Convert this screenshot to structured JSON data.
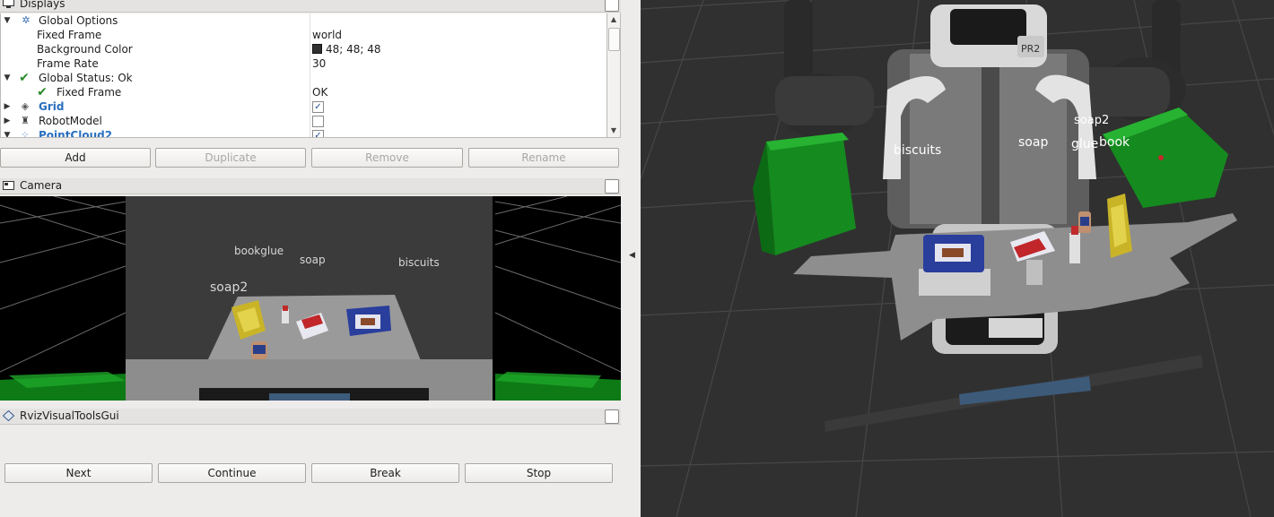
{
  "displays": {
    "title": "Displays",
    "rows": [
      {
        "label": "Global Options",
        "value": ""
      },
      {
        "label": "Fixed Frame",
        "value": "world"
      },
      {
        "label": "Background Color",
        "value": "48; 48; 48"
      },
      {
        "label": "Frame Rate",
        "value": "30"
      },
      {
        "label": "Global Status: Ok",
        "value": ""
      },
      {
        "label": "Fixed Frame",
        "value": "OK"
      },
      {
        "label": "Grid",
        "value": "",
        "checked": true
      },
      {
        "label": "RobotModel",
        "value": "",
        "checked": false
      },
      {
        "label": "PointCloud2",
        "value": "",
        "checked": true
      }
    ],
    "buttons": {
      "add": "Add",
      "duplicate": "Duplicate",
      "remove": "Remove",
      "rename": "Rename"
    }
  },
  "camera": {
    "title": "Camera",
    "labels": {
      "bookglue": "bookglue",
      "soap": "soap",
      "biscuits": "biscuits",
      "soap2": "soap2"
    }
  },
  "rviz_tools": {
    "title": "RvizVisualToolsGui",
    "buttons": {
      "next": "Next",
      "continue": "Continue",
      "break": "Break",
      "stop": "Stop"
    }
  },
  "scene": {
    "robot_badge": "PR2",
    "labels": {
      "biscuits": "biscuits",
      "soap": "soap",
      "soap2": "soap2",
      "glue": "glue",
      "book": "book"
    }
  },
  "colors": {
    "background": "#303030",
    "accent_blue": "#2a6fbe",
    "bin_green": "#1fa22a"
  }
}
